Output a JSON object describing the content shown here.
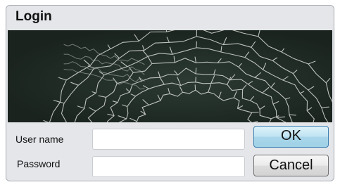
{
  "dialog": {
    "title": "Login",
    "user_name_label": "User name",
    "password_label": "Password",
    "user_name_value": "",
    "password_value": "",
    "ok_label": "OK",
    "cancel_label": "Cancel"
  },
  "colors": {
    "dialog_bg": "#e4e6e9",
    "banner_bg": "#1f2a24",
    "ok_accent": "#3c7fb1"
  },
  "banner": {
    "icon": "molecular-helix-image"
  }
}
